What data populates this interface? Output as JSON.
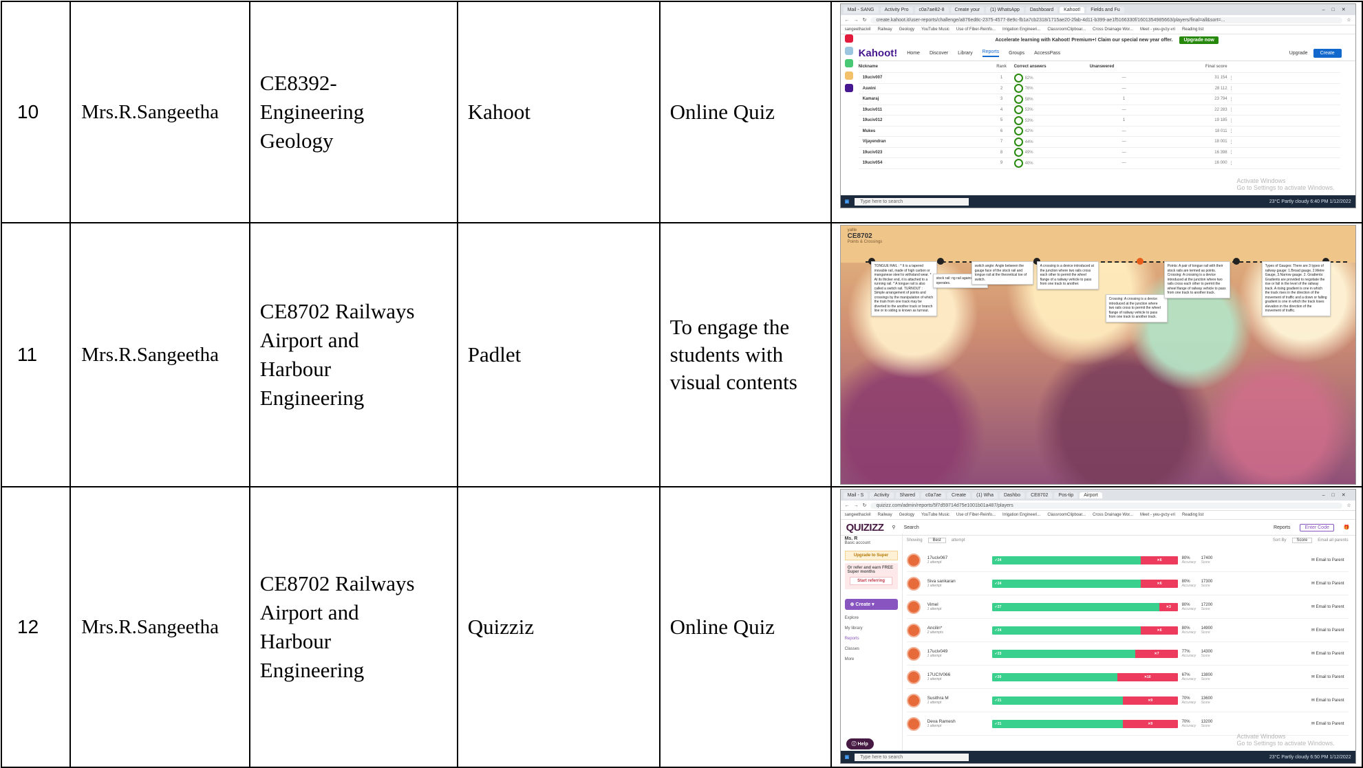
{
  "rows": [
    {
      "no": "10",
      "faculty": "Mrs.R.Sangeetha",
      "course": "CE8392-Engineering Geology",
      "course_lines": [
        "CE8392-",
        "Engineering",
        "Geology"
      ],
      "tool": "Kahoot",
      "purpose_lines": [
        "Online Quiz"
      ]
    },
    {
      "no": "11",
      "faculty": "Mrs.R.Sangeetha",
      "course_lines": [
        "CE8702 Railways",
        "Airport and",
        "Harbour",
        "Engineering"
      ],
      "tool": "Padlet",
      "purpose_lines": [
        "To engage the",
        "students with",
        "visual contents"
      ]
    },
    {
      "no": "12",
      "faculty": "Mrs.R.Sangeetha",
      "course_lines": [
        "CE8702 Railways",
        "Airport and",
        "Harbour",
        "Engineering"
      ],
      "tool": "Quizziz",
      "purpose_lines": [
        "Online Quiz"
      ]
    }
  ],
  "kahoot": {
    "tabs": [
      "Mail - SANG",
      "Activity Pro",
      "c0a7ae82-8",
      "Create your",
      "(1) WhatsApp",
      "Dashboard",
      "Kahoot!",
      "Fields and Fu"
    ],
    "url": "create.kahoot.it/user-reports/challenge/a876ed8c-2375-4577-8e9c-fb1a7cb2318/1715ae20-2fab-4d11-b399-ae1f5166330f/1601354985663/players/final=all&sort=...",
    "bookmarks": [
      "sangeethacivil",
      "Railway",
      "Geology",
      "YouTube Music",
      "Use of Fiber-Reinfo...",
      "Irrigation Engineeri...",
      "ClassroomClipboar...",
      "Cross Drainage Wor...",
      "Meet - yeu-gvzy-vri",
      "Reading list"
    ],
    "banner_text": "Accelerate learning with Kahoot! Premium+! Claim our special new year offer.",
    "banner_button": "Upgrade now",
    "logo": "Kahoot!",
    "nav": [
      "Home",
      "Discover",
      "Library",
      "Reports",
      "Groups",
      "AccessPass"
    ],
    "upgrade": "Upgrade",
    "create": "Create",
    "columns": [
      "Nickname",
      "Rank",
      "Correct answers",
      "Unanswered",
      "Final score"
    ],
    "players": [
      {
        "nick": "19uciv007",
        "rank": "1",
        "correct": "82%",
        "unanswered": "—",
        "score": "31 154"
      },
      {
        "nick": "Aswini",
        "rank": "2",
        "correct": "76%",
        "unanswered": "—",
        "score": "28 112"
      },
      {
        "nick": "Kamaraj",
        "rank": "3",
        "correct": "58%",
        "unanswered": "1",
        "score": "23 794"
      },
      {
        "nick": "19uciv011",
        "rank": "4",
        "correct": "53%",
        "unanswered": "—",
        "score": "22 283"
      },
      {
        "nick": "19uciv012",
        "rank": "5",
        "correct": "53%",
        "unanswered": "1",
        "score": "19 185"
      },
      {
        "nick": "Mukes",
        "rank": "6",
        "correct": "42%",
        "unanswered": "—",
        "score": "18 011"
      },
      {
        "nick": "Vijayendran",
        "rank": "7",
        "correct": "44%",
        "unanswered": "—",
        "score": "18 001"
      },
      {
        "nick": "19uciv023",
        "rank": "8",
        "correct": "49%",
        "unanswered": "—",
        "score": "16 398"
      },
      {
        "nick": "19uciv054",
        "rank": "9",
        "correct": "40%",
        "unanswered": "—",
        "score": "16 000"
      }
    ],
    "watermark": [
      "Activate Windows",
      "Go to Settings to activate Windows."
    ],
    "taskbar_search": "Type here to search",
    "tray": "23°C Partly cloudy  6:40 PM 1/12/2022"
  },
  "padlet": {
    "owner": "yallle",
    "title": "CE8702",
    "subtitle": "Points & Crossings",
    "cards": [
      {
        "title": "Tongue rail",
        "text": "TONGUE RAIL : * It is a tapered movable rail, made of high carbon or manganese steel to withstand wear. * At its thicker end, it is attached to a running rail. * A tongue rail is also called a switch rail. TURNOUT : Simple arrangement of points and crossings by the manipulation of which the train from one track may be diverted to the another track or branch line or to siding is known as turnout."
      },
      {
        "title": "Stock rail",
        "text": "stock rail: ng rail against which operates."
      },
      {
        "title": "Switch angle",
        "text": "switch angle: Angle between the gauge face of the stock rail and tongue rail at the theoretical toe of switch."
      },
      {
        "title": "Crossing angle",
        "text": "A crossing is a device introduced at the junction where two rails cross each other to permit the wheel flange of a railway vehicle to pass from one track to another."
      },
      {
        "title": "Crossing",
        "text": "Crossing: A crossing is a device introduced at the junction where two rails cross to permit the wheel flange of railway vehicle to pass from one track to another track."
      },
      {
        "title": "Points",
        "text": "Points: A pair of tongue rail with their stock rails are termed as points. Crossing: A crossing is a device introduced at the junction where two rails cross each other to permit the wheel flange of railway vehicle to pass from one track to another track."
      },
      {
        "title": "Types of Gauges",
        "text": "Types of Gauges: There are 3 types of railway gauge: 1.Broad gauge, 2.Metre Gauge, 3.Narrow gauge. 2. Gradients: Gradients are provided to negotiate the rise or fall in the level of the railway track. A rising gradient is one in which the track rises in the direction of the movement of traffic and a down or falling gradient is one in which the track loses elevation in the direction of the movement of traffic."
      }
    ]
  },
  "quizizz": {
    "tabs": [
      "Mail - S",
      "Activity",
      "Shared",
      "c0a7ae",
      "Create",
      "(1) Wha",
      "Dashbo",
      "CE8702",
      "Pos-tip",
      "Airport"
    ],
    "url": "quizizz.com/admin/reports/5f7d59714d75e1001b01a487/players",
    "bookmarks": [
      "sangeethacivil",
      "Railway",
      "Geology",
      "YouTube Music",
      "Use of Fiber-Reinfo...",
      "Irrigation Engineeri...",
      "ClassroomClipboar...",
      "Cross Drainage Wor...",
      "Meet - yeu-gvzy-vri",
      "Reading list"
    ],
    "logo": "QUIZIZZ",
    "search": "Search",
    "reports": "Reports",
    "enter_code": "Enter Code",
    "user": "Ms. R",
    "account": "Basic account",
    "upgrade": "Upgrade to Super",
    "refer_text": "Or refer and earn FREE Super months",
    "refer_btn": "Start referring",
    "create": "Create",
    "nav": [
      "Explore",
      "My library",
      "Reports",
      "Classes",
      "More"
    ],
    "help": "Help",
    "filter": {
      "showing": "Showing",
      "best": "Best",
      "attempt": "attempt",
      "sort_by": "Sort By",
      "score": "Score",
      "email_all": "Email all parents"
    },
    "players": [
      {
        "name": "17uciv067",
        "attempts": "1 attempt",
        "correct": "24",
        "wrong": "6",
        "accuracy": "80%",
        "score": "17400",
        "mail": "Email to Parent",
        "green": 0.8
      },
      {
        "name": "Siva sankaran",
        "attempts": "1 attempt",
        "correct": "24",
        "wrong": "6",
        "accuracy": "80%",
        "score": "17300",
        "mail": "Email to Parent",
        "green": 0.8
      },
      {
        "name": "Vimel",
        "attempts": "1 attempt",
        "correct": "27",
        "wrong": "3",
        "accuracy": "80%",
        "score": "17200",
        "mail": "Email to Parent",
        "green": 0.9
      },
      {
        "name": "Ancilin*",
        "attempts": "2 attempts",
        "correct": "24",
        "wrong": "6",
        "accuracy": "80%",
        "score": "14900",
        "mail": "Email to Parent",
        "green": 0.8
      },
      {
        "name": "17uciv049",
        "attempts": "1 attempt",
        "correct": "23",
        "wrong": "7",
        "accuracy": "77%",
        "score": "14300",
        "mail": "Email to Parent",
        "green": 0.77
      },
      {
        "name": "17UCIV066",
        "attempts": "1 attempt",
        "correct": "20",
        "wrong": "10",
        "accuracy": "67%",
        "score": "13800",
        "mail": "Email to Parent",
        "green": 0.67
      },
      {
        "name": "Susithra M",
        "attempts": "1 attempt",
        "correct": "21",
        "wrong": "9",
        "accuracy": "70%",
        "score": "13600",
        "mail": "Email to Parent",
        "green": 0.7
      },
      {
        "name": "Deva Ramesh",
        "attempts": "1 attempt",
        "correct": "21",
        "wrong": "9",
        "accuracy": "70%",
        "score": "13200",
        "mail": "Email to Parent",
        "green": 0.7
      }
    ],
    "labels": {
      "accuracy": "Accuracy",
      "score": "Score"
    },
    "watermark": [
      "Activate Windows",
      "Go to Settings to activate Windows."
    ],
    "taskbar_search": "Type here to search",
    "tray": "23°C Partly cloudy  6:50 PM 1/12/2022"
  }
}
